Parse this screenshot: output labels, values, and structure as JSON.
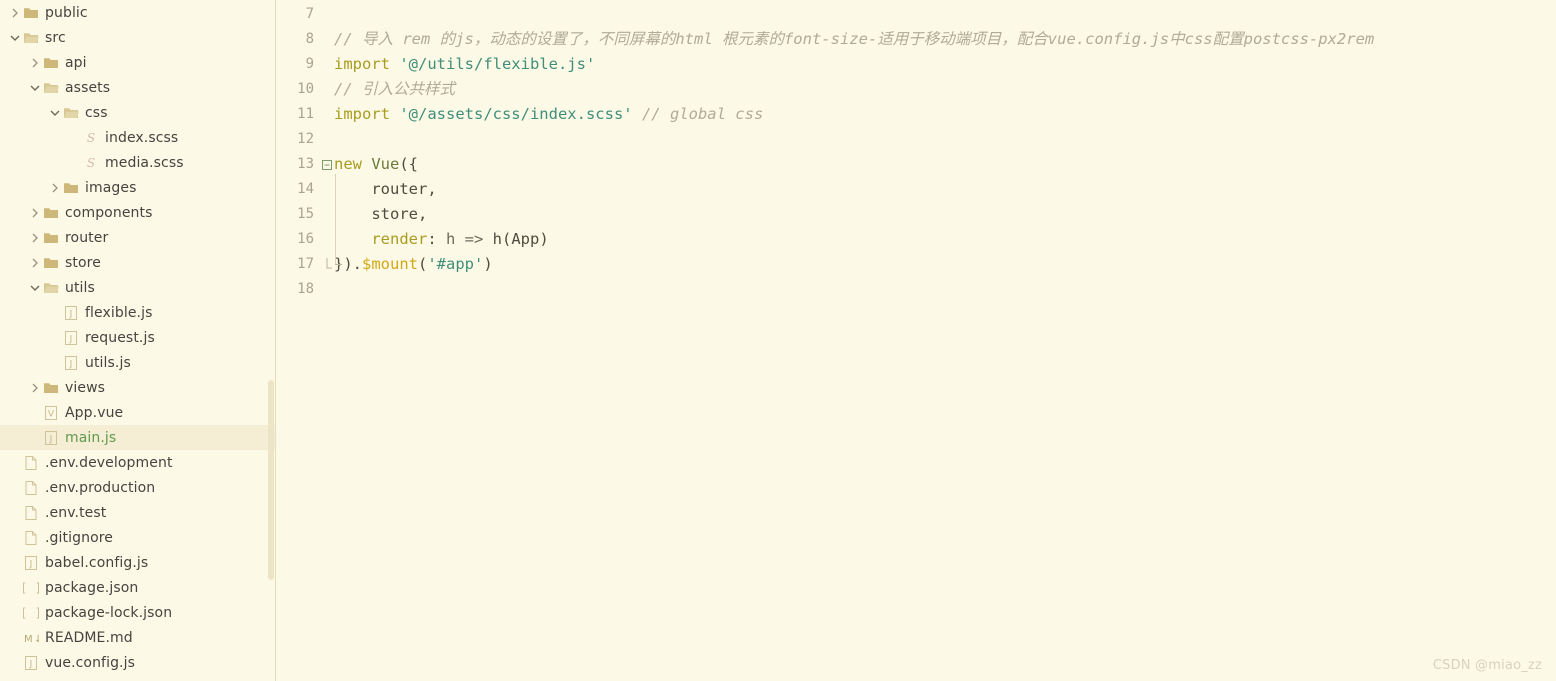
{
  "theme": {
    "background": "#fdf9e7",
    "selection": "#f5edd4",
    "text": "#45443e",
    "modified_file": "#5f9a4f",
    "gutter_text": "#a9a491",
    "comment": "#b0ab94",
    "keyword": "#a89c1f",
    "string": "#3f8f7a",
    "function": "#d1a818",
    "divider": "#e6ddb8"
  },
  "sidebar": {
    "name": "project-file-tree",
    "items": [
      {
        "label": "public",
        "type": "folder",
        "icon": "folder-icon",
        "indent": 0,
        "chevron": "right",
        "selected": false
      },
      {
        "label": "src",
        "type": "folder",
        "icon": "folder-open-icon",
        "indent": 0,
        "chevron": "down",
        "selected": false
      },
      {
        "label": "api",
        "type": "folder",
        "icon": "folder-icon",
        "indent": 1,
        "chevron": "right",
        "selected": false
      },
      {
        "label": "assets",
        "type": "folder",
        "icon": "folder-open-icon",
        "indent": 1,
        "chevron": "down",
        "selected": false
      },
      {
        "label": "css",
        "type": "folder",
        "icon": "folder-open-icon",
        "indent": 2,
        "chevron": "down",
        "selected": false
      },
      {
        "label": "index.scss",
        "type": "file",
        "icon": "scss-file-icon",
        "indent": 3,
        "chevron": "none",
        "selected": false
      },
      {
        "label": "media.scss",
        "type": "file",
        "icon": "scss-file-icon",
        "indent": 3,
        "chevron": "none",
        "selected": false
      },
      {
        "label": "images",
        "type": "folder",
        "icon": "folder-icon",
        "indent": 2,
        "chevron": "right",
        "selected": false
      },
      {
        "label": "components",
        "type": "folder",
        "icon": "folder-icon",
        "indent": 1,
        "chevron": "right",
        "selected": false
      },
      {
        "label": "router",
        "type": "folder",
        "icon": "folder-icon",
        "indent": 1,
        "chevron": "right",
        "selected": false
      },
      {
        "label": "store",
        "type": "folder",
        "icon": "folder-icon",
        "indent": 1,
        "chevron": "right",
        "selected": false
      },
      {
        "label": "utils",
        "type": "folder",
        "icon": "folder-open-icon",
        "indent": 1,
        "chevron": "down",
        "selected": false
      },
      {
        "label": "flexible.js",
        "type": "file",
        "icon": "js-file-icon",
        "indent": 2,
        "chevron": "none",
        "selected": false
      },
      {
        "label": "request.js",
        "type": "file",
        "icon": "js-file-icon",
        "indent": 2,
        "chevron": "none",
        "selected": false
      },
      {
        "label": "utils.js",
        "type": "file",
        "icon": "js-file-icon",
        "indent": 2,
        "chevron": "none",
        "selected": false
      },
      {
        "label": "views",
        "type": "folder",
        "icon": "folder-icon",
        "indent": 1,
        "chevron": "right",
        "selected": false
      },
      {
        "label": "App.vue",
        "type": "file",
        "icon": "vue-file-icon",
        "indent": 1,
        "chevron": "none",
        "selected": false
      },
      {
        "label": "main.js",
        "type": "file",
        "icon": "js-file-icon",
        "indent": 1,
        "chevron": "none",
        "selected": true
      },
      {
        "label": ".env.development",
        "type": "file",
        "icon": "plain-file-icon",
        "indent": 0,
        "chevron": "none",
        "selected": false
      },
      {
        "label": ".env.production",
        "type": "file",
        "icon": "plain-file-icon",
        "indent": 0,
        "chevron": "none",
        "selected": false
      },
      {
        "label": ".env.test",
        "type": "file",
        "icon": "plain-file-icon",
        "indent": 0,
        "chevron": "none",
        "selected": false
      },
      {
        "label": ".gitignore",
        "type": "file",
        "icon": "plain-file-icon",
        "indent": 0,
        "chevron": "none",
        "selected": false
      },
      {
        "label": "babel.config.js",
        "type": "file",
        "icon": "js-file-icon",
        "indent": 0,
        "chevron": "none",
        "selected": false
      },
      {
        "label": "package.json",
        "type": "file",
        "icon": "json-file-icon",
        "indent": 0,
        "chevron": "none",
        "selected": false
      },
      {
        "label": "package-lock.json",
        "type": "file",
        "icon": "json-file-icon",
        "indent": 0,
        "chevron": "none",
        "selected": false
      },
      {
        "label": "README.md",
        "type": "file",
        "icon": "markdown-file-icon",
        "indent": 0,
        "chevron": "none",
        "selected": false
      },
      {
        "label": "vue.config.js",
        "type": "file",
        "icon": "js-file-icon",
        "indent": 0,
        "chevron": "none",
        "selected": false
      }
    ]
  },
  "editor": {
    "name": "code-editor",
    "first_line_number": 7,
    "lines": [
      {
        "num": "7",
        "fold": "",
        "tokens": []
      },
      {
        "num": "8",
        "fold": "",
        "tokens": [
          {
            "t": "// 导入 rem 的js，动态的设置了，不同屏幕的html 根元素的font-size-适用于移动端项目，配合vue.config.js中css配置postcss-px2rem",
            "c": "c-comment"
          }
        ]
      },
      {
        "num": "9",
        "fold": "",
        "tokens": [
          {
            "t": "import ",
            "c": "c-keyword"
          },
          {
            "t": "'@/utils/flexible.js'",
            "c": "c-string"
          }
        ]
      },
      {
        "num": "10",
        "fold": "",
        "tokens": [
          {
            "t": "// 引入公共样式",
            "c": "c-comment"
          }
        ]
      },
      {
        "num": "11",
        "fold": "",
        "tokens": [
          {
            "t": "import ",
            "c": "c-keyword"
          },
          {
            "t": "'@/assets/css/index.scss' ",
            "c": "c-string"
          },
          {
            "t": "// global css",
            "c": "c-comment"
          }
        ]
      },
      {
        "num": "12",
        "fold": "",
        "tokens": []
      },
      {
        "num": "13",
        "fold": "minus",
        "tokens": [
          {
            "t": "new ",
            "c": "c-keyword"
          },
          {
            "t": "Vue",
            "c": "c-classname"
          },
          {
            "t": "({",
            "c": "c-plain"
          }
        ]
      },
      {
        "num": "14",
        "fold": "",
        "tokens": [
          {
            "t": "    router,",
            "c": "c-plain"
          }
        ]
      },
      {
        "num": "15",
        "fold": "",
        "tokens": [
          {
            "t": "    store,",
            "c": "c-plain"
          }
        ]
      },
      {
        "num": "16",
        "fold": "",
        "tokens": [
          {
            "t": "    ",
            "c": "c-plain"
          },
          {
            "t": "render",
            "c": "c-prop"
          },
          {
            "t": ": ",
            "c": "c-plain"
          },
          {
            "t": "h ",
            "c": "c-op"
          },
          {
            "t": "=> ",
            "c": "c-op"
          },
          {
            "t": "h(App)",
            "c": "c-plain"
          }
        ]
      },
      {
        "num": "17",
        "fold": "end",
        "tokens": [
          {
            "t": "}).",
            "c": "c-plain"
          },
          {
            "t": "$mount",
            "c": "c-fn"
          },
          {
            "t": "(",
            "c": "c-plain"
          },
          {
            "t": "'#app'",
            "c": "c-string"
          },
          {
            "t": ")",
            "c": "c-plain"
          }
        ]
      },
      {
        "num": "18",
        "fold": "",
        "tokens": []
      }
    ]
  },
  "watermark": {
    "text": "CSDN @miao_zz"
  }
}
